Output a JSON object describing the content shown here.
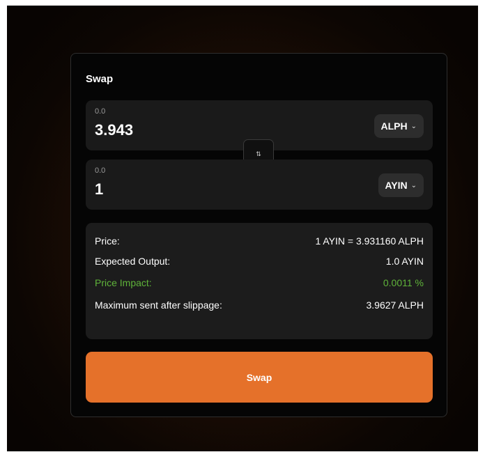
{
  "title": "Swap",
  "from": {
    "placeholder": "0.0",
    "amount": "3.943",
    "token": "ALPH"
  },
  "to": {
    "placeholder": "0.0",
    "amount": "1",
    "token": "AYIN"
  },
  "switch_icon": "swap-arrows-icon",
  "details": {
    "price_label": "Price:",
    "price_value": "1 AYIN = 3.931160 ALPH",
    "expected_label": "Expected Output:",
    "expected_value": "1.0 AYIN",
    "impact_label": "Price Impact:",
    "impact_value": "0.0011 %",
    "max_sent_label": "Maximum sent after slippage:",
    "max_sent_value": "3.9627 ALPH"
  },
  "swap_button": "Swap",
  "colors": {
    "accent": "#e5712a",
    "impact": "#5fb33a",
    "panel": "#1a1a1a"
  }
}
